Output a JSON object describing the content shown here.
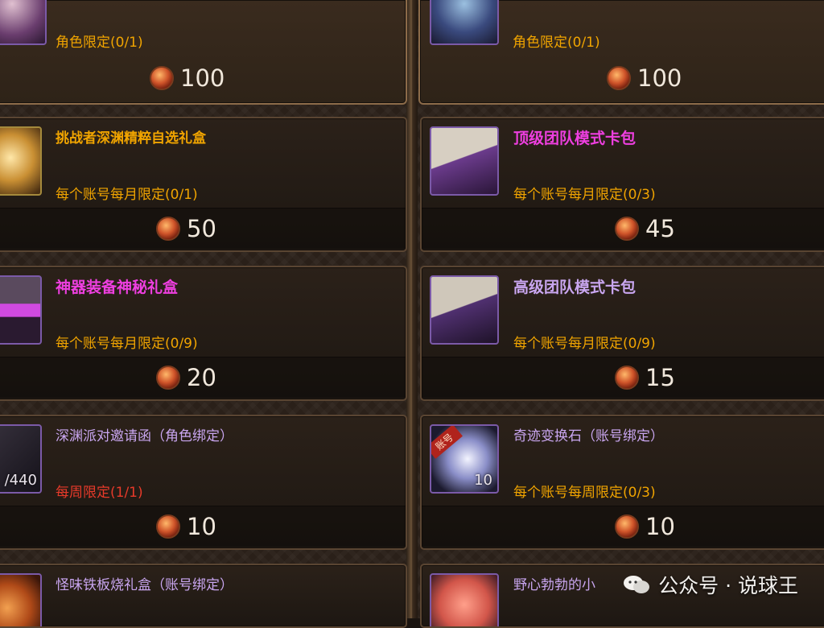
{
  "cards": {
    "r0l": {
      "limit": "角色限定(0/1)",
      "price": "100"
    },
    "r0r": {
      "limit": "角色限定(0/1)",
      "price": "100"
    },
    "r1l": {
      "title": "挑战者深渊精粹自选礼盒",
      "limit": "每个账号每月限定(0/1)",
      "price": "50"
    },
    "r1r": {
      "title": "顶级团队模式卡包",
      "limit": "每个账号每月限定(0/3)",
      "price": "45"
    },
    "r2l": {
      "title": "神器装备神秘礼盒",
      "limit": "每个账号每月限定(0/9)",
      "price": "20"
    },
    "r2r": {
      "title": "高级团队模式卡包",
      "limit": "每个账号每月限定(0/9)",
      "price": "15"
    },
    "r3l": {
      "title": "深渊派对邀请函（角色绑定）",
      "limit": "每周限定(1/1)",
      "price": "10",
      "qty": "/440"
    },
    "r3r": {
      "title": "奇迹变换石（账号绑定）",
      "limit": "每个账号每周限定(0/3)",
      "price": "10",
      "qty": "10",
      "badge": "账号"
    },
    "r4l": {
      "title": "怪味铁板烧礼盒（账号绑定）"
    },
    "r4r": {
      "title": "野心勃勃的小"
    }
  },
  "watermark": {
    "text": "公众号 · 说球王"
  },
  "colors": {
    "gold": "#f0a400",
    "red": "#e73a2a",
    "magenta": "#ee3fe0",
    "lavender": "#c9a6f0"
  }
}
